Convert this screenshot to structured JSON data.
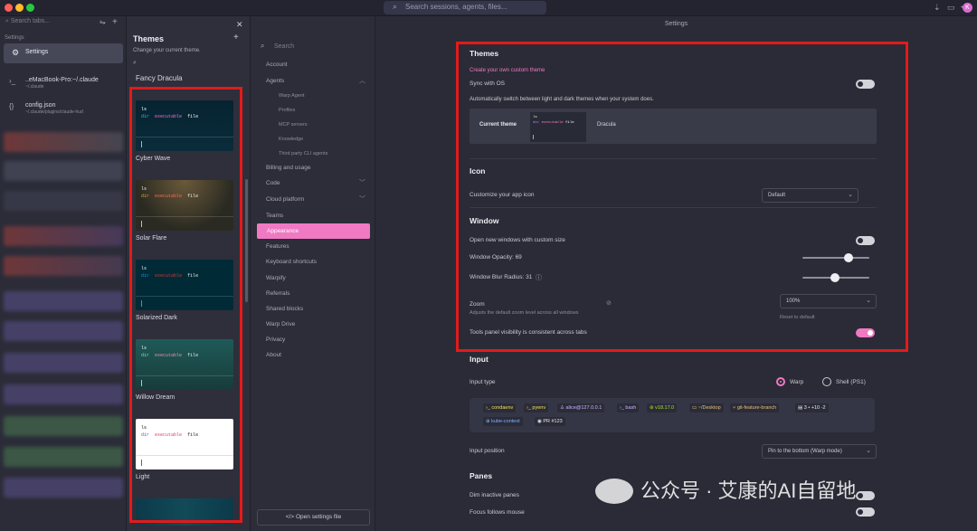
{
  "titlebar": {
    "search_placeholder": "Search sessions, agents, files...",
    "avatar_letter": "K",
    "dots": [
      "#ff5f57",
      "#febc2e",
      "#28c840"
    ]
  },
  "left": {
    "search_placeholder": "Search tabs...",
    "section_label": "Settings",
    "settings_tab": "Settings",
    "tabs": [
      {
        "title": "..eMacBook-Pro:~/.claude",
        "sub": "~/.claude"
      },
      {
        "title": "config.json",
        "sub": "~/.claude/plugins/claude-hud"
      }
    ]
  },
  "themes": {
    "title": "Themes",
    "subtitle": "Change your current theme.",
    "current": "Fancy Dracula",
    "preview_lines": {
      "ls": "ls",
      "dir": "dir",
      "exec": "executable",
      "file": "file"
    },
    "items": [
      {
        "name": "Cyber Wave"
      },
      {
        "name": "Solar Flare"
      },
      {
        "name": "Solarized Dark"
      },
      {
        "name": "Willow Dream"
      },
      {
        "name": "Light"
      }
    ]
  },
  "nav": {
    "search_placeholder": "Search",
    "items": {
      "account": "Account",
      "agents": "Agents",
      "warp_agent": "Warp Agent",
      "profiles": "Profiles",
      "mcp": "MCP servers",
      "knowledge": "Knowledge",
      "third_party": "Third party CLI agents",
      "billing": "Billing and usage",
      "code": "Code",
      "cloud": "Cloud platform",
      "teams": "Teams",
      "appearance": "Appearance",
      "features": "Features",
      "shortcuts": "Keyboard shortcuts",
      "warpify": "Warpify",
      "referrals": "Referrals",
      "shared_blocks": "Shared blocks",
      "warp_drive": "Warp Drive",
      "privacy": "Privacy",
      "about": "About"
    },
    "open_file": "Open settings file"
  },
  "main": {
    "header": "Settings",
    "themes": {
      "title": "Themes",
      "create_link": "Create your own custom theme",
      "sync_os": "Sync with OS",
      "auto_switch": "Automatically switch between light and dark themes when your system does.",
      "current_theme_label": "Current theme",
      "current_theme_value": "Dracula"
    },
    "icon": {
      "title": "Icon",
      "customize": "Customize your app icon",
      "value": "Default"
    },
    "window": {
      "title": "Window",
      "custom_size": "Open new windows with custom size",
      "opacity": "Window Opacity: 69",
      "blur": "Window Blur Radius: 31",
      "zoom": "Zoom",
      "zoom_desc": "Adjusts the default zoom level across all windows",
      "zoom_value": "100%",
      "reset": "Reset to default",
      "tools_panel": "Tools panel visibility is consistent across tabs"
    },
    "input": {
      "title": "Input",
      "type_label": "Input type",
      "warp": "Warp",
      "shell": "Shell (PS1)",
      "position_label": "Input position",
      "position_value": "Pin to the bottom (Warp mode)",
      "chips": [
        "condaenv",
        "pyenv",
        "alice@127.0.0.1",
        "bash",
        "v18.17.0",
        "~/Desktop",
        "git-feature-branch",
        "3 • +10 -2",
        "kube-context",
        "PR #123"
      ]
    },
    "panes": {
      "title": "Panes",
      "dim": "Dim inactive panes",
      "focus": "Focus follows mouse"
    }
  },
  "settings_state": {
    "window_opacity": 69,
    "window_blur_radius": 31
  },
  "watermark": "公众号 · 艾康的AI自留地"
}
